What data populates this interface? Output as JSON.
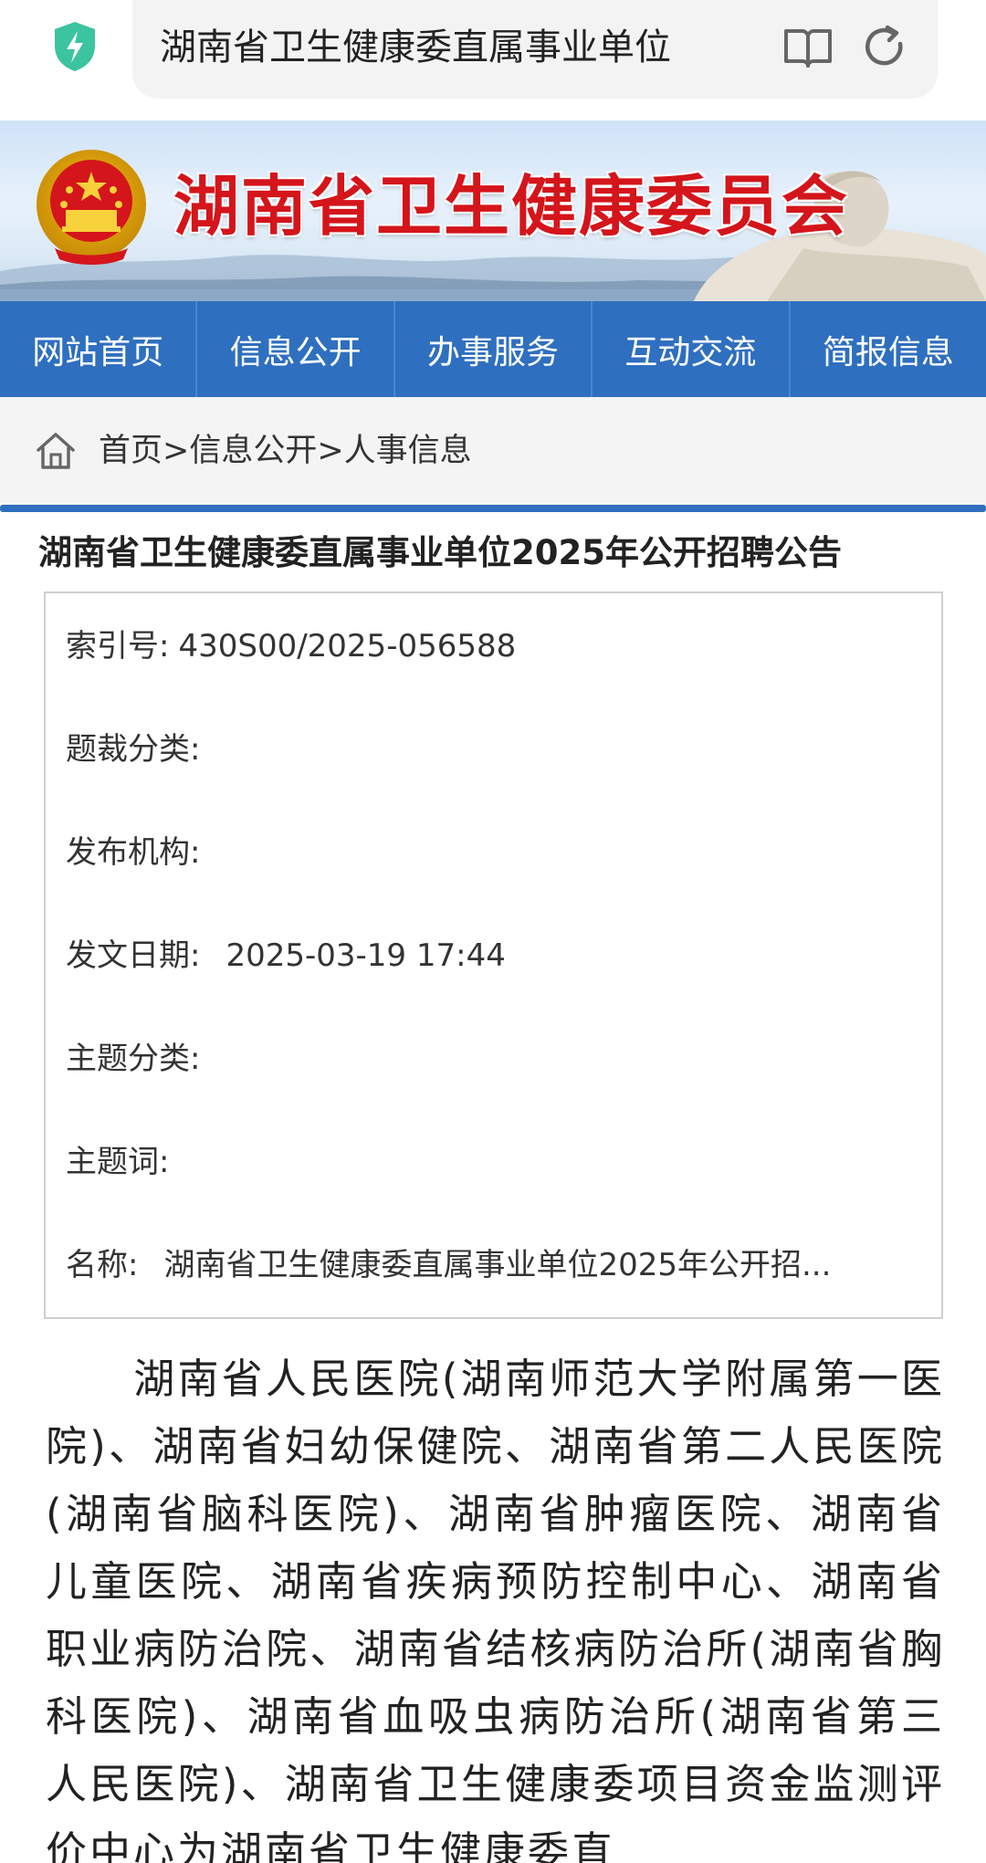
{
  "browser": {
    "url_title": "湖南省卫生健康委直属事业单位"
  },
  "banner": {
    "site_title": "湖南省卫生健康委员会"
  },
  "nav": {
    "items": [
      {
        "label": "网站首页"
      },
      {
        "label": "信息公开"
      },
      {
        "label": "办事服务"
      },
      {
        "label": "互动交流"
      },
      {
        "label": "简报信息"
      }
    ]
  },
  "breadcrumb": {
    "text": "首页>信息公开>人事信息"
  },
  "article": {
    "title": "湖南省卫生健康委直属事业单位2025年公开招聘公告",
    "meta": [
      {
        "label": "索引号:",
        "value": "430S00/2025-056588"
      },
      {
        "label": "题裁分类:",
        "value": ""
      },
      {
        "label": "发布机构:",
        "value": ""
      },
      {
        "label": "发文日期:",
        "value": "2025-03-19 17:44"
      },
      {
        "label": "主题分类:",
        "value": ""
      },
      {
        "label": "主题词:",
        "value": ""
      },
      {
        "label": "名称:",
        "value": "湖南省卫生健康委直属事业单位2025年公开招..."
      }
    ],
    "body": "湖南省人民医院(湖南师范大学附属第一医院)、湖南省妇幼保健院、湖南省第二人民医院(湖南省脑科医院)、湖南省肿瘤医院、湖南省儿童医院、湖南省疾病预防控制中心、湖南省职业病防治院、湖南省结核病防治所(湖南省胸科医院)、湖南省血吸虫病防治所(湖南省第三人民医院)、湖南省卫生健康委项目资金监测评价中心为湖南省卫生健康委直"
  },
  "colors": {
    "nav_bg": "#2f6fbf",
    "banner_title": "#d4151b",
    "shield": "#3cc3a0"
  }
}
